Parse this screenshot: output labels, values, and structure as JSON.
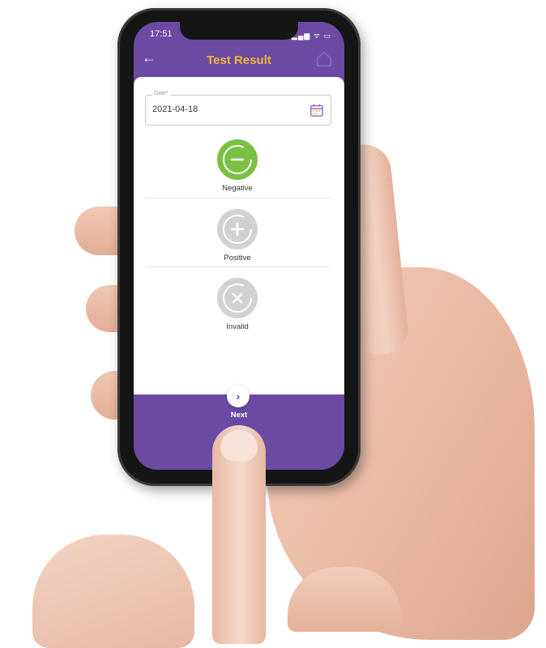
{
  "status_bar": {
    "time": "17:51",
    "icons": "signal-wifi-battery"
  },
  "header": {
    "title": "Test Result",
    "back_icon": "arrow-left-icon",
    "home_icon": "home-icon"
  },
  "date_field": {
    "label": "Date*",
    "value": "2021-04-18",
    "icon": "calendar-icon"
  },
  "options": [
    {
      "label": "Negative",
      "icon": "minus-circle-icon",
      "selected": true,
      "color": "#7ac143"
    },
    {
      "label": "Positive",
      "icon": "plus-circle-icon",
      "selected": false,
      "color": "#cfcfcf"
    },
    {
      "label": "Invalid",
      "icon": "x-circle-icon",
      "selected": false,
      "color": "#cfcfcf"
    }
  ],
  "footer": {
    "next_label": "Next",
    "next_icon": "chevron-right-icon"
  },
  "colors": {
    "brand": "#6a4aa2",
    "title": "#f0b53a",
    "selected": "#7ac143"
  }
}
